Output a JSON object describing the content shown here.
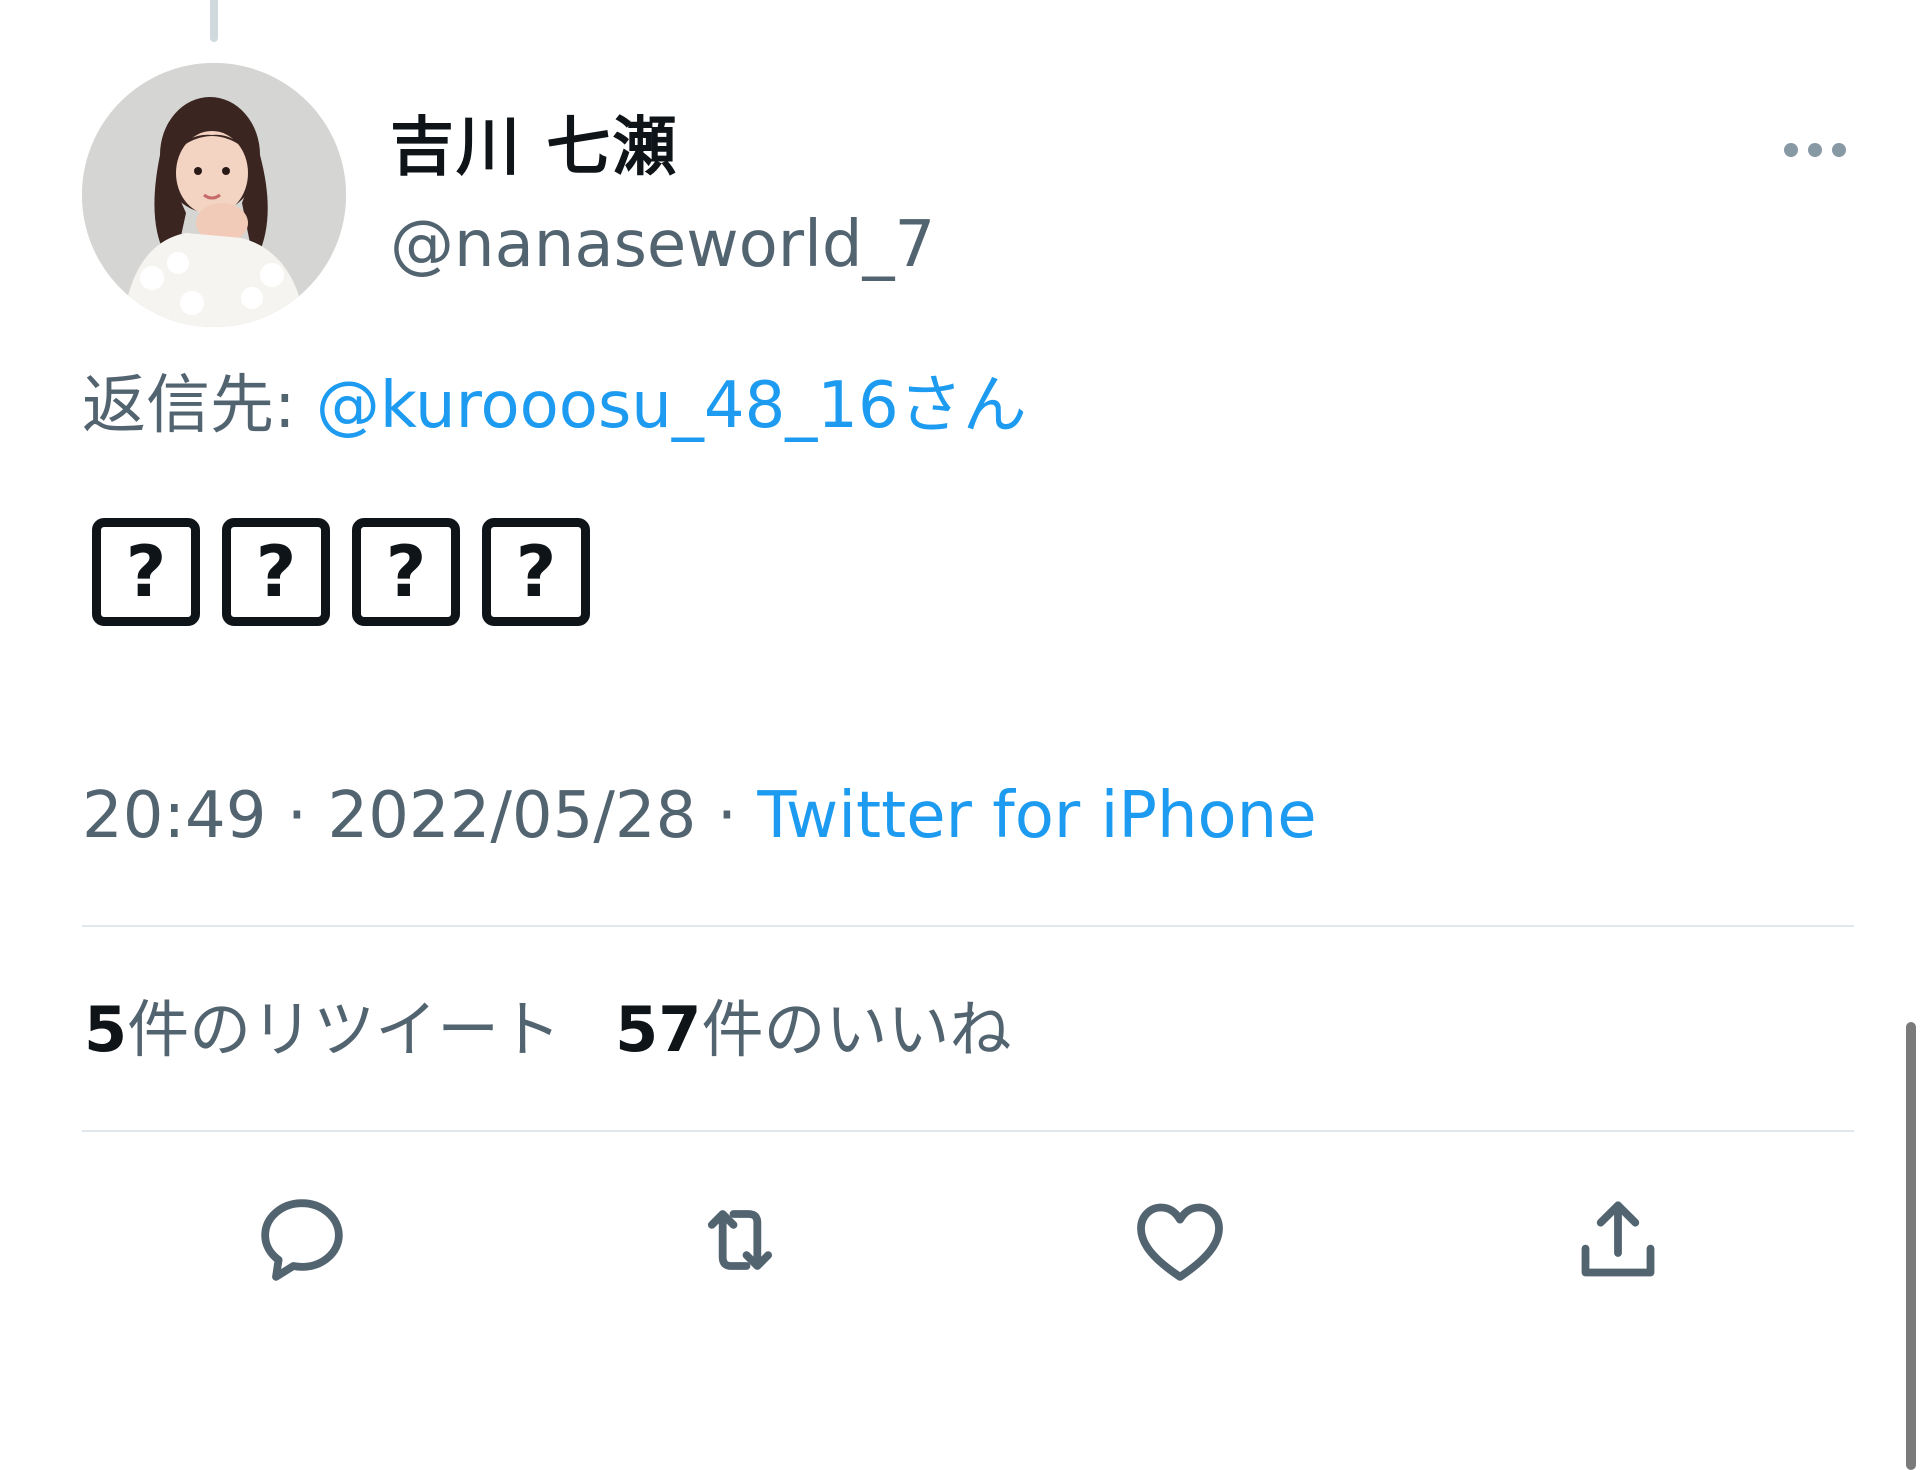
{
  "tweet": {
    "author": {
      "display_name": "吉川 七瀬",
      "handle": "@nanaseworld_7",
      "avatar_icon": "profile-photo"
    },
    "reply_to": {
      "prefix": "返信先: ",
      "target": "@kurooosu_48_16さん"
    },
    "body": {
      "glyphs": [
        "?",
        "?",
        "?",
        "?"
      ]
    },
    "meta": {
      "time": "20:49",
      "separator": " · ",
      "date": "2022/05/28",
      "source": "Twitter for iPhone"
    },
    "stats": {
      "retweets_count": "5",
      "retweets_label": "件のリツイート",
      "likes_count": "57",
      "likes_label": "件のいいね"
    },
    "actions": [
      "reply-icon",
      "retweet-icon",
      "like-icon",
      "share-icon"
    ]
  },
  "colors": {
    "text": "#0f1419",
    "muted": "#536471",
    "link": "#1d9bf0",
    "divider": "#e1e8ed"
  }
}
